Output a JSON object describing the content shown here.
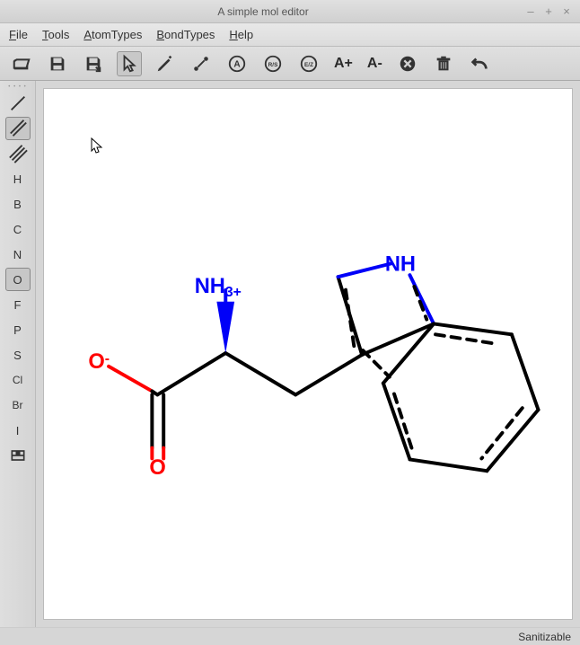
{
  "window": {
    "title": "A simple mol editor"
  },
  "menu": {
    "file": "File",
    "tools": "Tools",
    "atomtypes": "AtomTypes",
    "bondtypes": "BondTypes",
    "help": "Help"
  },
  "toolbar": {
    "open_icon": "folder-open-icon",
    "save_icon": "save-icon",
    "saveas_icon": "saveas-icon",
    "select_icon": "cursor-icon",
    "draw_icon": "pencil-icon",
    "bond_icon": "bond-tool-icon",
    "atom_icon": "atom-a-icon",
    "rs_icon": "rs-icon",
    "ez_icon": "ez-icon",
    "bigger_label": "A+",
    "smaller_label": "A-",
    "remove_icon": "remove-atom-icon",
    "delete_icon": "trash-icon",
    "undo_icon": "undo-icon"
  },
  "side": {
    "bond_single": "single-bond-icon",
    "bond_double": "double-bond-icon",
    "bond_triple": "triple-bond-icon",
    "elements": [
      "H",
      "B",
      "C",
      "N",
      "O",
      "F",
      "P",
      "S",
      "Cl",
      "Br",
      "I"
    ],
    "selected_element": "O",
    "ptable_icon": "periodic-table-icon"
  },
  "molecule": {
    "nh3_label": "NH",
    "nh3_charge": "3+",
    "nh_label": "NH",
    "o_minus_label": "O",
    "o_minus_charge": "-",
    "o_dbl_label": "O"
  },
  "status": {
    "text": "Sanitizable"
  }
}
